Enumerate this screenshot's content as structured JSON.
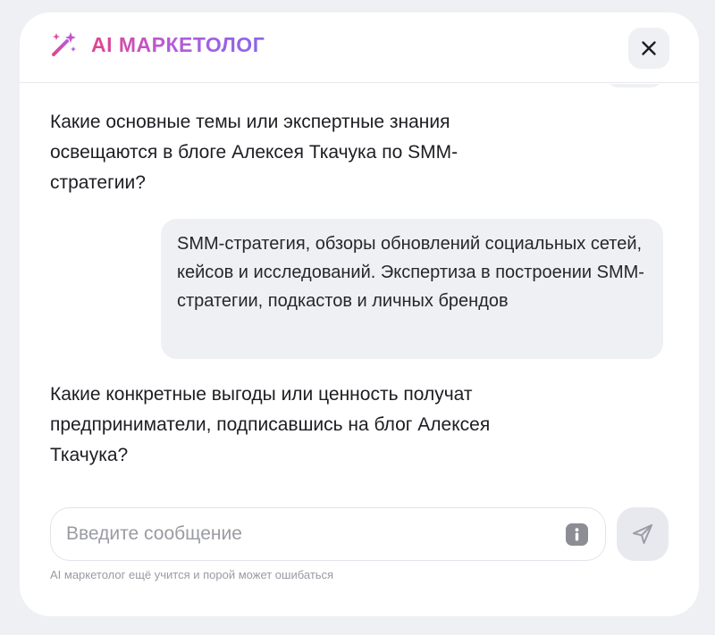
{
  "header": {
    "title": "AI МАРКЕТОЛОГ",
    "logo_icon": "magic-wand-icon",
    "close_icon": "close-icon"
  },
  "messages": [
    {
      "role": "assistant",
      "text": "Какие основные темы или экспертные знания освещаются в блоге Алексея Ткачука по SMM-стратегии?"
    },
    {
      "role": "user",
      "text": "SMM-стратегия, обзоры обновлений социальных сетей, кейсов и исследований. Экспертиза в построении SMM-стратегии, подкастов и личных брендов"
    },
    {
      "role": "assistant",
      "text": "Какие конкретные выгоды или ценность получат предприниматели, подписавшись на блог Алексея Ткачука?"
    }
  ],
  "composer": {
    "placeholder": "Введите сообщение",
    "value": "",
    "info_icon": "info-icon",
    "send_icon": "send-icon"
  },
  "footer": {
    "disclaimer": "AI маркетолог ещё учится и порой может ошибаться"
  },
  "colors": {
    "brand_gradient_start": "#e2458e",
    "brand_gradient_end": "#8866ec",
    "bubble_bg": "#eff0f4",
    "page_bg": "#eef0f4"
  }
}
